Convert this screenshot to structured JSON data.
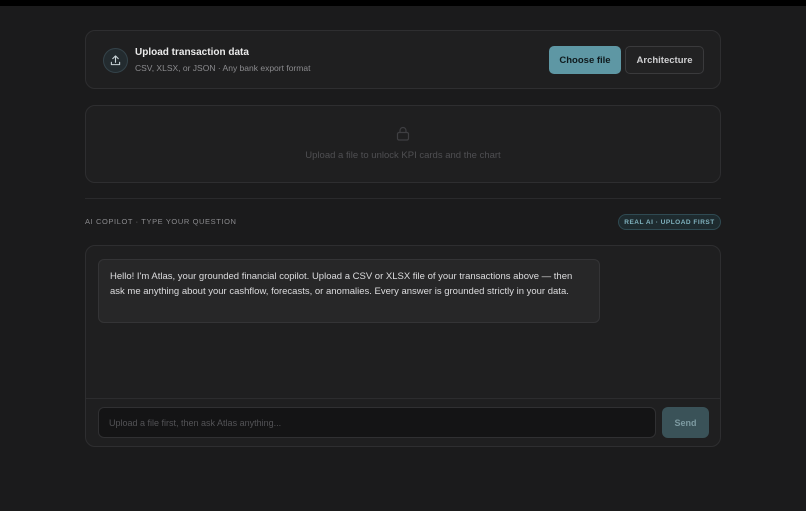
{
  "upload": {
    "title": "Upload transaction data",
    "subtitle": "CSV, XLSX, or JSON · Any bank export format",
    "choose_label": "Choose file",
    "architecture_label": "Architecture",
    "icon": "upload-icon"
  },
  "kpi": {
    "placeholder": "Upload a file to unlock KPI cards and the chart",
    "icon": "lock-icon"
  },
  "copilot": {
    "section_label": "AI COPILOT · TYPE YOUR QUESTION",
    "badge": "REAL AI · UPLOAD FIRST",
    "message": "Hello! I'm Atlas, your grounded financial copilot. Upload a CSV or XLSX file of your transactions above — then ask me anything about your cashflow, forecasts, or anomalies. Every answer is grounded strictly in your data.",
    "input_placeholder": "Upload a file first, then ask Atlas anything...",
    "input_value": "",
    "send_label": "Send"
  },
  "colors": {
    "background": "#1b1b1c",
    "accent": "#5e97a4",
    "badge_text": "#7fb1bd"
  }
}
